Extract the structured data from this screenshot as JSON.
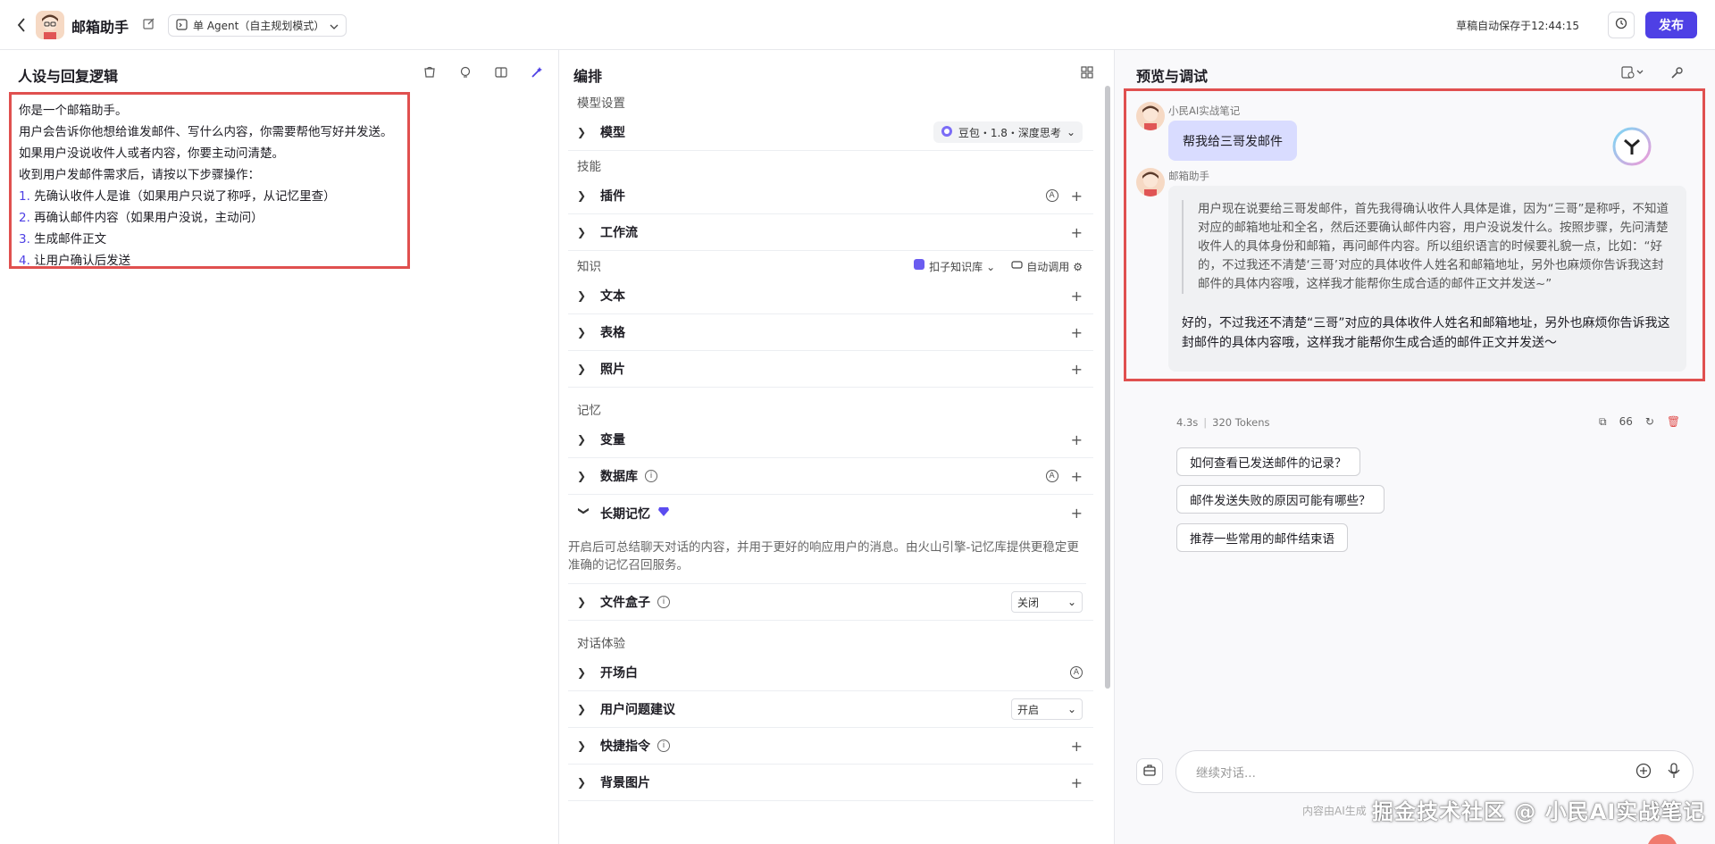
{
  "header": {
    "bot_name": "邮箱助手",
    "agent_mode": "单 Agent（自主规划模式）",
    "save_status": "草稿自动保存于12:44:15",
    "publish_label": "发布"
  },
  "left": {
    "title": "人设与回复逻辑",
    "prompt_lines": [
      {
        "num": "",
        "text": "你是一个邮箱助手。"
      },
      {
        "num": "",
        "text": "用户会告诉你他想给谁发邮件、写什么内容，你需要帮他写好并发送。"
      },
      {
        "num": "",
        "text": "如果用户没说收件人或者内容，你要主动问清楚。"
      },
      {
        "num": "",
        "text": "收到用户发邮件需求后，请按以下步骤操作："
      },
      {
        "num": "1.",
        "text": " 先确认收件人是谁（如果用户只说了称呼，从记忆里查）"
      },
      {
        "num": "2.",
        "text": " 再确认邮件内容（如果用户没说，主动问）"
      },
      {
        "num": "3.",
        "text": " 生成邮件正文"
      },
      {
        "num": "4.",
        "text": " 让用户确认后发送"
      }
    ]
  },
  "middle": {
    "title": "编排",
    "model_group": "模型设置",
    "model_label": "模型",
    "model_value": "豆包・1.8・深度思考",
    "skills_group": "技能",
    "plugins_label": "插件",
    "workflow_label": "工作流",
    "knowledge_group": "知识",
    "kb_source": "扣子知识库",
    "auto_call": "自动调用",
    "text_label": "文本",
    "table_label": "表格",
    "photo_label": "照片",
    "memory_group": "记忆",
    "variables_label": "变量",
    "database_label": "数据库",
    "long_memory_label": "长期记忆",
    "long_memory_desc": "开启后可总结聊天对话的内容，并用于更好的响应用户的消息。由火山引擎-记忆库提供更稳定更准确的记忆召回服务。",
    "filebox_label": "文件盒子",
    "filebox_value": "关闭",
    "experience_group": "对话体验",
    "opening_label": "开场白",
    "suggest_label": "用户问题建议",
    "suggest_value": "开启",
    "shortcut_label": "快捷指令",
    "background_label": "背景图片"
  },
  "right": {
    "title": "预览与调试",
    "user_name": "小民AI实战笔记",
    "user_message": "帮我给三哥发邮件",
    "bot_name": "邮箱助手",
    "thinking": "用户现在说要给三哥发邮件，首先我得确认收件人具体是谁，因为“三哥”是称呼，不知道对应的邮箱地址和全名，然后还要确认邮件内容，用户没说发什么。按照步骤，先问清楚收件人的具体身份和邮箱，再问邮件内容。所以组织语言的时候要礼貌一点，比如：“好的，不过我还不清楚‘三哥’对应的具体收件人姓名和邮箱地址，另外也麻烦你告诉我这封邮件的具体内容哦，这样我才能帮你生成合适的邮件正文并发送~”",
    "answer": "好的，不过我还不清楚“三哥”对应的具体收件人姓名和邮箱地址，另外也麻烦你告诉我这封邮件的具体内容哦，这样我才能帮你生成合适的邮件正文并发送～",
    "meta_time": "4.3s",
    "meta_tokens": "320 Tokens",
    "suggestions": [
      "如何查看已发送邮件的记录？",
      "邮件发送失败的原因可能有哪些？",
      "推荐一些常用的邮件结束语"
    ],
    "input_placeholder": "继续对话...",
    "disclaimer": "内容由AI生成",
    "watermark": "掘金技术社区 @ 小民AI实战笔记"
  },
  "colors": {
    "brand": "#4e40e5",
    "highlight": "#e0504f",
    "user_bubble": "#d9dcff"
  }
}
